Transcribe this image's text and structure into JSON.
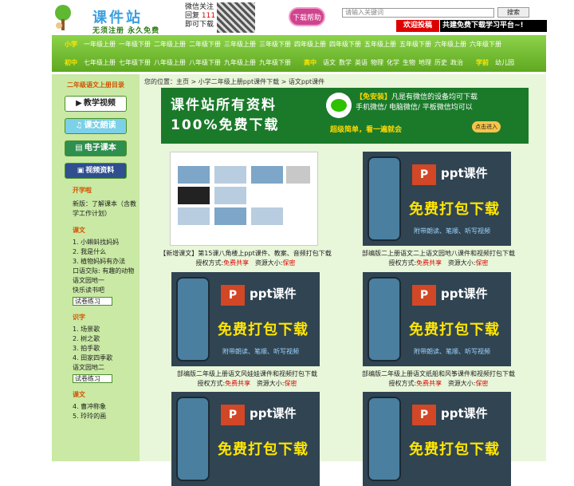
{
  "header": {
    "logo_title": "课件站",
    "logo_tagline": "无须注册 永久免费",
    "wechat_lines": [
      "微信关注",
      "回复",
      "111",
      "即可下载"
    ],
    "download_help": "下载帮助",
    "search_placeholder": "请输入关键词",
    "search_button": "搜索",
    "contribute": "欢迎投稿",
    "slogan": "共建免费下载学习平台~!"
  },
  "nav": {
    "row1_label": "小学",
    "row1": [
      "一年级上册",
      "一年级下册",
      "二年级上册",
      "二年级下册",
      "三年级上册",
      "三年级下册",
      "四年级上册",
      "四年级下册",
      "五年级上册",
      "五年级下册",
      "六年级上册",
      "六年级下册"
    ],
    "row2_label": "初中",
    "row2": [
      "七年级上册",
      "七年级下册",
      "八年级上册",
      "八年级下册",
      "九年级上册",
      "九年级下册"
    ],
    "row2_label_hs": "高中",
    "row2_hs": [
      "语文",
      "数学",
      "英语",
      "物理",
      "化学",
      "生物",
      "地理",
      "历史",
      "政治"
    ],
    "row2_label_pre": "学前",
    "row2_pre": [
      "幼儿园"
    ]
  },
  "sidebar": {
    "title": "二年级语文上册目录",
    "buttons": [
      "教学视频",
      "课文朗读",
      "电子课本",
      "视频资料"
    ],
    "sections": [
      {
        "title": "开学啦",
        "items": [
          "新版：了解课本（含教学工作计划）"
        ],
        "test": ""
      },
      {
        "title": "课文",
        "items": [
          "1. 小蝌蚪找妈妈",
          "2. 我是什么",
          "3. 植物妈妈有办法",
          "口语交际: 有趣的动物",
          "语文园地一",
          "快乐读书吧"
        ],
        "test": "试卷练习"
      },
      {
        "title": "识字",
        "items": [
          "1. 场景歌",
          "2. 树之歌",
          "3. 拍手歌",
          "4. 田家四季歌",
          "语文园地二"
        ],
        "test": "试卷练习"
      },
      {
        "title": "课文",
        "items": [
          "4. 曹冲称象",
          "5. 玲玲的画"
        ],
        "test": ""
      }
    ]
  },
  "main": {
    "breadcrumb": "您的位置：主页 > 小学二年级上册ppt课件下载 > 语文ppt课件",
    "banner": {
      "big1": "课件站所有资料",
      "big2": "100%免费下载",
      "line1_tag": "【免安装】",
      "line1": "凡是有微信的设备均可下载",
      "line2": "手机微信/ 电脑微信/ 平板微信均可以",
      "line3": "超级简单，看一遍就会",
      "click": "点击进入"
    },
    "ppt": {
      "title": "ppt课件",
      "free": "免费打包下载",
      "note": "附带朗读、笔顺、听写视频"
    },
    "cards": [
      {
        "title": "【新增课文】第15课八角楼上ppt课件、教案、音频打包下载",
        "auth_label": "授权方式:",
        "auth": "免费共享",
        "size_label": "资源大小:",
        "size": "保密"
      },
      {
        "title": "部编版二上册语文二上语文园地八课件和视频打包下载",
        "auth_label": "授权方式:",
        "auth": "免费共享",
        "size_label": "资源大小:",
        "size": "保密"
      },
      {
        "title": "部编版二年级上册语文风娃娃课件和视频打包下载",
        "auth_label": "授权方式:",
        "auth": "免费共享",
        "size_label": "资源大小:",
        "size": "保密"
      },
      {
        "title": "部编版二年级上册语文纸船和风筝课件和视频打包下载",
        "auth_label": "授权方式:",
        "auth": "免费共享",
        "size_label": "资源大小:",
        "size": "保密"
      },
      {
        "title": "",
        "auth_label": "",
        "auth": "",
        "size_label": "",
        "size": ""
      },
      {
        "title": "",
        "auth_label": "",
        "auth": "",
        "size_label": "",
        "size": ""
      }
    ]
  }
}
